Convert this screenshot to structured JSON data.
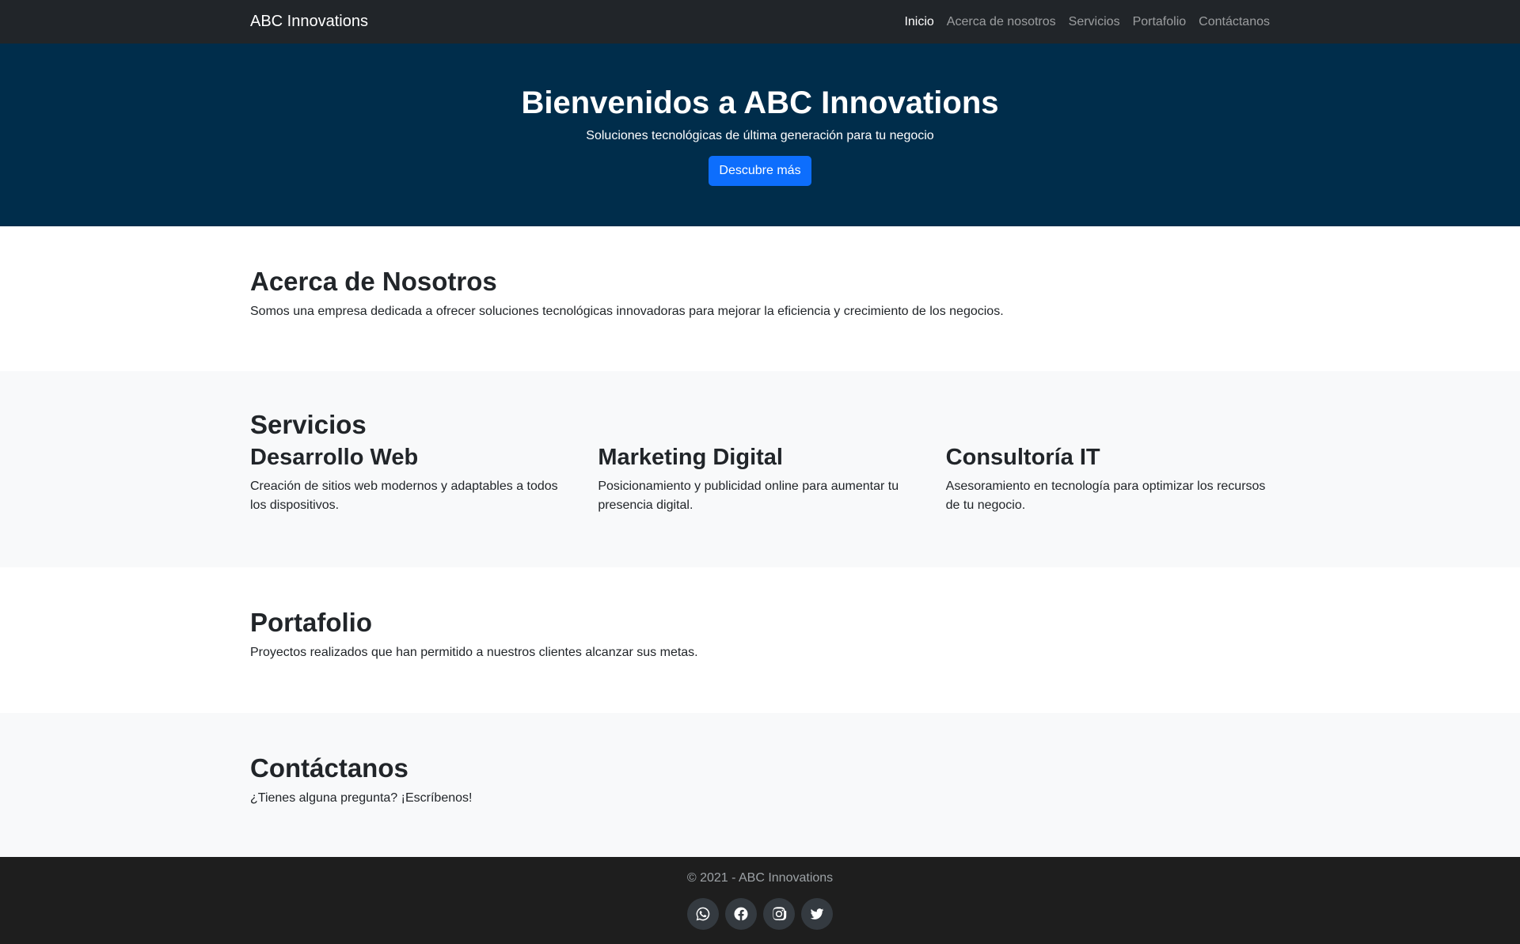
{
  "navbar": {
    "brand": "ABC Innovations",
    "links": [
      "Inicio",
      "Acerca de nosotros",
      "Servicios",
      "Portafolio",
      "Contáctanos"
    ],
    "active_index": 0
  },
  "hero": {
    "title": "Bienvenidos a ABC Innovations",
    "subtitle": "Soluciones tecnológicas de última generación para tu negocio",
    "cta_label": "Descubre más",
    "background_color": "#002d4b",
    "cta_color": "#0d6efd"
  },
  "about": {
    "title": "Acerca de Nosotros",
    "text": "Somos una empresa dedicada a ofrecer soluciones tecnológicas innovadoras para mejorar la eficiencia y crecimiento de los negocios."
  },
  "services": {
    "title": "Servicios",
    "items": [
      {
        "title": "Desarrollo Web",
        "text": "Creación de sitios web modernos y adaptables a todos los dispositivos."
      },
      {
        "title": "Marketing Digital",
        "text": "Posicionamiento y publicidad online para aumentar tu presencia digital."
      },
      {
        "title": "Consultoría IT",
        "text": "Asesoramiento en tecnología para optimizar los recursos de tu negocio."
      }
    ]
  },
  "portfolio": {
    "title": "Portafolio",
    "text": "Proyectos realizados que han permitido a nuestros clientes alcanzar sus metas."
  },
  "contact": {
    "title": "Contáctanos",
    "text": "¿Tienes alguna pregunta? ¡Escríbenos!"
  },
  "footer": {
    "copyright": "© 2021 - ABC Innovations",
    "social_icons": [
      "whatsapp-icon",
      "facebook-icon",
      "instagram-icon",
      "twitter-icon"
    ]
  }
}
